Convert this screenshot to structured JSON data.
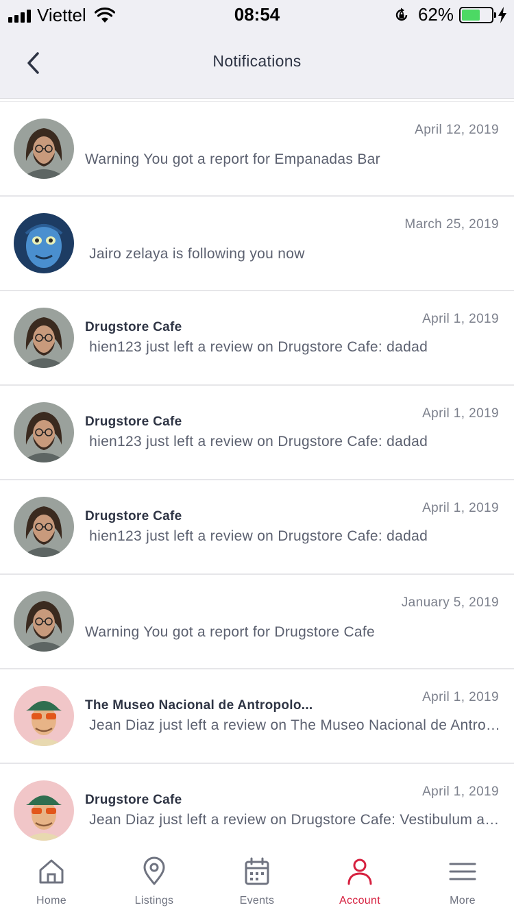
{
  "status_bar": {
    "carrier": "Viettel",
    "time": "08:54",
    "battery": "62%",
    "battery_level": 0.62
  },
  "header": {
    "title": "Notifications"
  },
  "notifications": [
    {
      "avatar": "man-beard-glasses",
      "title": "",
      "date": "April 12, 2019",
      "body": "Warning You got a report for Empanadas Bar"
    },
    {
      "avatar": "blue-alien-face",
      "title": "",
      "date": "March 25, 2019",
      "body": " Jairo zelaya is following you now"
    },
    {
      "avatar": "man-beard-glasses",
      "title": "Drugstore Cafe",
      "date": "April 1, 2019",
      "body": " hien123 just left a review on Drugstore Cafe: dadad"
    },
    {
      "avatar": "man-beard-glasses",
      "title": "Drugstore Cafe",
      "date": "April 1, 2019",
      "body": " hien123 just left a review on Drugstore Cafe: dadad"
    },
    {
      "avatar": "man-beard-glasses",
      "title": "Drugstore Cafe",
      "date": "April 1, 2019",
      "body": " hien123 just left a review on Drugstore Cafe: dadad"
    },
    {
      "avatar": "man-beard-glasses",
      "title": "",
      "date": "January 5, 2019",
      "body": "Warning You got a report for Drugstore Cafe"
    },
    {
      "avatar": "man-cap-sunglasses",
      "title": "The Museo Nacional de Antropolo...",
      "date": "April 1, 2019",
      "body": " Jean Diaz just left a review on The Museo Nacional de Antropología"
    },
    {
      "avatar": "man-cap-sunglasses",
      "title": "Drugstore Cafe",
      "date": "April 1, 2019",
      "body": " Jean Diaz just left a review on Drugstore Cafe: Vestibulum ante ipsum"
    }
  ],
  "tab_bar": {
    "active_color": "#d6203f",
    "items": [
      {
        "label": "Home",
        "icon": "home-icon"
      },
      {
        "label": "Listings",
        "icon": "map-pin-icon"
      },
      {
        "label": "Events",
        "icon": "calendar-icon"
      },
      {
        "label": "Account",
        "icon": "user-icon"
      },
      {
        "label": "More",
        "icon": "menu-icon"
      }
    ]
  }
}
